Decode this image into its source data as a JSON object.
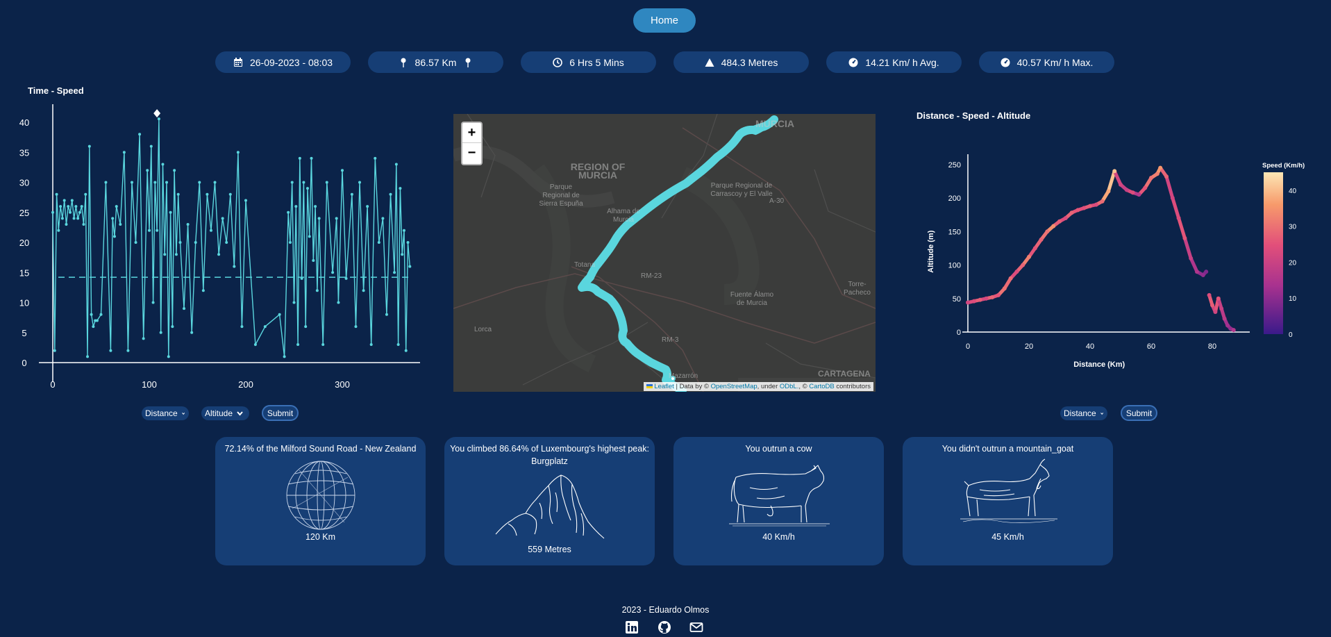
{
  "nav": {
    "home_label": "Home"
  },
  "stats": [
    {
      "icon": "calendar-icon",
      "value": "26-09-2023 - 08:03"
    },
    {
      "icon": "map-pin-icon",
      "value": "86.57 Km"
    },
    {
      "icon": "clock-icon",
      "value": "6 Hrs 5 Mins"
    },
    {
      "icon": "mountain-icon",
      "value": "484.3 Metres"
    },
    {
      "icon": "speedometer-icon",
      "value": "14.21 Km/ h Avg."
    },
    {
      "icon": "speedometer-icon",
      "value": "40.57 Km/ h Max."
    }
  ],
  "chart_data": [
    {
      "type": "line",
      "title": "Time - Speed",
      "xlabel": "",
      "ylabel": "",
      "xlim": [
        0,
        385
      ],
      "ylim": [
        0,
        42
      ],
      "x_ticks": [
        0,
        100,
        200,
        300
      ],
      "y_ticks": [
        0,
        5,
        10,
        15,
        20,
        25,
        30,
        35,
        40
      ],
      "average_line": 14.21,
      "max_marker": {
        "x": 108,
        "y": 40.57
      },
      "series": [
        {
          "color": "#5ad6de",
          "x": [
            0,
            2,
            4,
            6,
            8,
            10,
            12,
            14,
            16,
            18,
            20,
            22,
            24,
            26,
            28,
            30,
            32,
            34,
            36,
            38,
            40,
            42,
            44,
            46,
            50,
            55,
            60,
            62,
            64,
            66,
            70,
            74,
            78,
            82,
            86,
            90,
            94,
            98,
            100,
            102,
            104,
            106,
            108,
            110,
            112,
            114,
            116,
            118,
            120,
            122,
            124,
            126,
            128,
            130,
            132,
            136,
            140,
            144,
            148,
            152,
            156,
            160,
            164,
            168,
            172,
            176,
            180,
            184,
            188,
            192,
            196,
            200,
            210,
            220,
            235,
            240,
            244,
            246,
            248,
            250,
            252,
            254,
            256,
            258,
            260,
            262,
            264,
            266,
            268,
            270,
            272,
            274,
            276,
            280,
            284,
            290,
            294,
            296,
            300,
            304,
            310,
            314,
            318,
            322,
            326,
            330,
            334,
            338,
            342,
            346,
            350,
            354,
            356,
            358,
            360,
            362,
            364,
            366,
            368,
            370
          ],
          "y": [
            25,
            2,
            28,
            22,
            26,
            24,
            27,
            23,
            26,
            25,
            27,
            24,
            26,
            24,
            25,
            26,
            23,
            28,
            1,
            36,
            8,
            6,
            7,
            7,
            8,
            30,
            2,
            24,
            21,
            26,
            23,
            35,
            2,
            30,
            20,
            38,
            4,
            32,
            22,
            36,
            10,
            30,
            22,
            40.57,
            5,
            33,
            18,
            30,
            1,
            25,
            6,
            32,
            18,
            28,
            20,
            9,
            23,
            5,
            20,
            30,
            12,
            28,
            22,
            30,
            18,
            24,
            20,
            28,
            16,
            35,
            6,
            27,
            3,
            6,
            8,
            1,
            25,
            20,
            30,
            10,
            26,
            3,
            34,
            14,
            30,
            6,
            29,
            21,
            34,
            17,
            26,
            12,
            24,
            3,
            30,
            15,
            24,
            10,
            32,
            14,
            28,
            6,
            30,
            12,
            26,
            3,
            34,
            20,
            24,
            8,
            28,
            15,
            33,
            3,
            29,
            18,
            22,
            2,
            20,
            16
          ]
        }
      ]
    },
    {
      "type": "scatter",
      "title": "Distance - Speed - Altitude",
      "xlabel": "Distance (Km)",
      "ylabel": "Altitude (m)",
      "xlim": [
        0,
        92
      ],
      "ylim": [
        0,
        265
      ],
      "x_ticks": [
        0,
        20,
        40,
        60,
        80
      ],
      "y_ticks": [
        0,
        50,
        100,
        150,
        200,
        250
      ],
      "colorbar": {
        "label": "Speed (Km/h)",
        "ticks": [
          0,
          10,
          20,
          30,
          40
        ]
      },
      "points": [
        {
          "x": 0,
          "y": 44,
          "c": 20
        },
        {
          "x": 2,
          "y": 46,
          "c": 22
        },
        {
          "x": 4,
          "y": 48,
          "c": 25
        },
        {
          "x": 6,
          "y": 50,
          "c": 21
        },
        {
          "x": 8,
          "y": 52,
          "c": 26
        },
        {
          "x": 10,
          "y": 55,
          "c": 24
        },
        {
          "x": 12,
          "y": 65,
          "c": 28
        },
        {
          "x": 14,
          "y": 80,
          "c": 27
        },
        {
          "x": 16,
          "y": 90,
          "c": 22
        },
        {
          "x": 18,
          "y": 100,
          "c": 26
        },
        {
          "x": 20,
          "y": 112,
          "c": 30
        },
        {
          "x": 22,
          "y": 125,
          "c": 24
        },
        {
          "x": 24,
          "y": 138,
          "c": 26
        },
        {
          "x": 26,
          "y": 150,
          "c": 28
        },
        {
          "x": 28,
          "y": 158,
          "c": 32
        },
        {
          "x": 30,
          "y": 165,
          "c": 25
        },
        {
          "x": 32,
          "y": 170,
          "c": 22
        },
        {
          "x": 34,
          "y": 178,
          "c": 26
        },
        {
          "x": 36,
          "y": 182,
          "c": 24
        },
        {
          "x": 38,
          "y": 185,
          "c": 23
        },
        {
          "x": 40,
          "y": 188,
          "c": 25
        },
        {
          "x": 42,
          "y": 190,
          "c": 22
        },
        {
          "x": 44,
          "y": 195,
          "c": 27
        },
        {
          "x": 46,
          "y": 210,
          "c": 35
        },
        {
          "x": 48,
          "y": 240,
          "c": 38
        },
        {
          "x": 50,
          "y": 220,
          "c": 20
        },
        {
          "x": 52,
          "y": 212,
          "c": 18
        },
        {
          "x": 54,
          "y": 208,
          "c": 22
        },
        {
          "x": 56,
          "y": 205,
          "c": 15
        },
        {
          "x": 58,
          "y": 215,
          "c": 24
        },
        {
          "x": 60,
          "y": 230,
          "c": 28
        },
        {
          "x": 62,
          "y": 236,
          "c": 30
        },
        {
          "x": 63,
          "y": 245,
          "c": 33
        },
        {
          "x": 65,
          "y": 232,
          "c": 26
        },
        {
          "x": 67,
          "y": 200,
          "c": 20
        },
        {
          "x": 69,
          "y": 170,
          "c": 22
        },
        {
          "x": 71,
          "y": 140,
          "c": 24
        },
        {
          "x": 73,
          "y": 110,
          "c": 18
        },
        {
          "x": 75,
          "y": 90,
          "c": 14
        },
        {
          "x": 77,
          "y": 85,
          "c": 10
        },
        {
          "x": 78,
          "y": 90,
          "c": 8
        },
        {
          "x": 79,
          "y": 55,
          "c": 22
        },
        {
          "x": 80,
          "y": 40,
          "c": 25
        },
        {
          "x": 81,
          "y": 30,
          "c": 20
        },
        {
          "x": 82,
          "y": 50,
          "c": 24
        },
        {
          "x": 83,
          "y": 35,
          "c": 18
        },
        {
          "x": 84,
          "y": 20,
          "c": 16
        },
        {
          "x": 85,
          "y": 10,
          "c": 12
        },
        {
          "x": 86,
          "y": 5,
          "c": 10
        },
        {
          "x": 87,
          "y": 3,
          "c": 14
        }
      ]
    }
  ],
  "map": {
    "labels": [
      {
        "name": "MURCIA"
      },
      {
        "name": "REGION OF MURCIA"
      },
      {
        "name": "Parque Regional de Sierra Espuña"
      },
      {
        "name": "Parque Regional de Carrascoy y El Valle"
      },
      {
        "name": "Alhama de Murcia"
      },
      {
        "name": "Totana"
      },
      {
        "name": "Lorca"
      },
      {
        "name": "Fuente Álamo de Murcia"
      },
      {
        "name": "Torre-Pacheco"
      },
      {
        "name": "CARTAGENA"
      },
      {
        "name": "Mazarrón"
      },
      {
        "name": "RM-23"
      },
      {
        "name": "RM-3"
      },
      {
        "name": "A-30"
      }
    ],
    "zoom_in": "+",
    "zoom_out": "−",
    "attribution": {
      "leaflet": "Leaflet",
      "sep1": " | Data by © ",
      "osm": "OpenStreetMap",
      "sep2": ", under ",
      "odbl": "ODbL.",
      "sep3": ", © ",
      "cartodb": "CartoDB",
      "sep4": " contributors"
    }
  },
  "left_controls": {
    "x_select": "Distance",
    "y_select": "Altitude",
    "submit": "Submit"
  },
  "right_controls": {
    "x_select": "Distance",
    "submit": "Submit"
  },
  "cards": [
    {
      "title": "72.14% of the Milford Sound Road - New Zealand",
      "value": "120 Km",
      "image": "globe"
    },
    {
      "title": "You climbed 86.64% of Luxembourg's highest peak: Burgplatz",
      "value": "559 Metres",
      "image": "mountain"
    },
    {
      "title": "You outrun a cow",
      "value": "40 Km/h",
      "image": "cow"
    },
    {
      "title": "You didn't outrun a mountain_goat",
      "value": "45 Km/h",
      "image": "goat"
    }
  ],
  "footer": {
    "text": "2023 - Eduardo Olmos"
  },
  "colors": {
    "background": "#0b2349",
    "pill": "#163e75",
    "line": "#5ad6de",
    "home": "#2f87c0"
  }
}
